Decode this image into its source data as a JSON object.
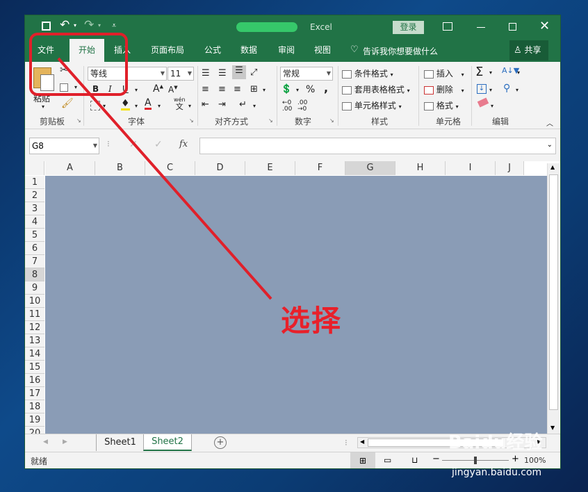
{
  "title_bar": {
    "app_title_partial": "Excel",
    "login_label": "登录"
  },
  "tabs": [
    {
      "label": "文件"
    },
    {
      "label": "开始"
    },
    {
      "label": "插入"
    },
    {
      "label": "页面布局"
    },
    {
      "label": "公式"
    },
    {
      "label": "数据"
    },
    {
      "label": "审阅"
    },
    {
      "label": "视图"
    }
  ],
  "tell_me": "告诉我你想要做什么",
  "share_label": "共享",
  "ribbon": {
    "groups": {
      "clipboard": "剪贴板",
      "font": "字体",
      "alignment": "对齐方式",
      "number": "数字",
      "styles": "样式",
      "cells": "单元格",
      "editing": "编辑"
    },
    "paste_label": "粘贴",
    "font_name": "等线",
    "font_size": "11",
    "bold": "B",
    "italic": "I",
    "underline": "U",
    "number_format": "常规",
    "percent": "%",
    "comma": ",",
    "conditional_format": "条件格式",
    "table_format": "套用表格格式",
    "cell_styles": "单元格样式",
    "insert": "插入",
    "delete": "删除",
    "format": "格式",
    "wen": "wén",
    "wen_char": "文"
  },
  "formula_bar": {
    "name_box": "G8",
    "fx": "fx",
    "value": ""
  },
  "columns": [
    "A",
    "B",
    "C",
    "D",
    "E",
    "F",
    "G",
    "H",
    "I",
    "J"
  ],
  "rows": [
    "1",
    "2",
    "3",
    "4",
    "5",
    "6",
    "7",
    "8",
    "9",
    "10",
    "11",
    "12",
    "13",
    "14",
    "15",
    "16",
    "17",
    "18",
    "19",
    "20"
  ],
  "sheets": [
    {
      "label": "Sheet1",
      "active": false
    },
    {
      "label": "Sheet2",
      "active": true
    }
  ],
  "status": {
    "ready": "就绪",
    "zoom": "100%"
  },
  "annotation": {
    "text": "选择",
    "color": "#e8202a"
  },
  "watermark": {
    "brand": "Baidu经验",
    "url": "jingyan.baidu.com"
  },
  "colors": {
    "excel_green": "#217346",
    "selection_fill": "#8a9cb6"
  }
}
